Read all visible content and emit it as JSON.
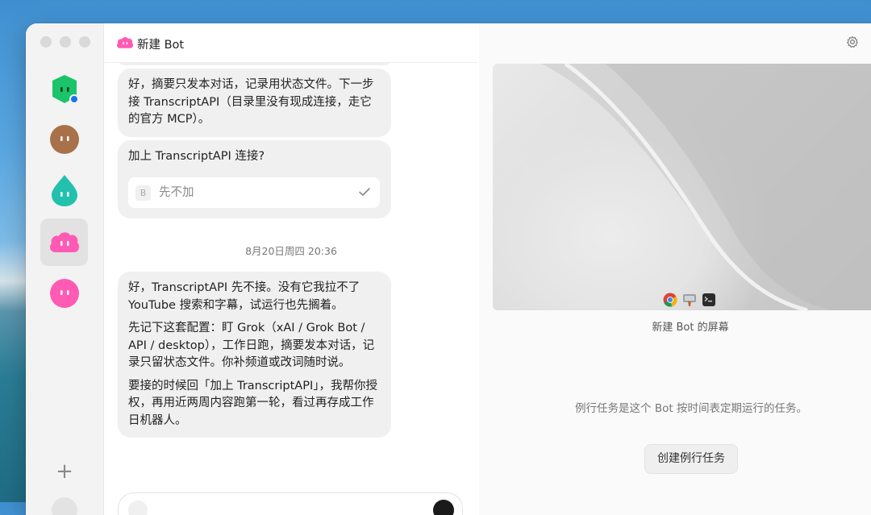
{
  "app": {
    "bot_name": "新建 Bot"
  },
  "sidebar": {
    "bots": [
      {
        "name": "green-bot",
        "color": "#1bc46a"
      },
      {
        "name": "brown-bot",
        "color": "#a8714a"
      },
      {
        "name": "teal-bot",
        "color": "#21c1ad"
      },
      {
        "name": "pink-cloud-bot",
        "color": "#ff5ab4"
      },
      {
        "name": "pink-bot",
        "color": "#ff5ab4"
      }
    ],
    "add_label": "+"
  },
  "chat": {
    "messages": [
      {
        "text": "好，摘要只发本对话，记录用状态文件。下一步接 TranscriptAPI（目录里没有现成连接，走它的官方 MCP）。"
      },
      {
        "question": "加上 TranscriptAPI 连接?",
        "option": {
          "key": "B",
          "label": "先不加"
        }
      }
    ],
    "timestamp": "8月20日周四 20:36",
    "reply_paragraphs": [
      "好，TranscriptAPI 先不接。没有它我拉不了 YouTube 搜索和字幕，试运行也先搁着。",
      "先记下这套配置：盯 Grok（xAI / Grok Bot / API / desktop），工作日跑，摘要发本对话，记录只留状态文件。你补频道或改词随时说。",
      "要接的时候回「加上 TranscriptAPI」，我帮你授权，再用近两周内容跑第一轮，看过再存成工作日机器人。"
    ]
  },
  "right_panel": {
    "screen_label": "新建 Bot 的屏幕",
    "routine_description": "例行任务是这个 Bot 按时间表定期运行的任务。",
    "create_routine_button": "创建例行任务"
  },
  "colors": {
    "accent_blue": "#1a73e8",
    "bubble_bg": "#f0f0f0"
  }
}
